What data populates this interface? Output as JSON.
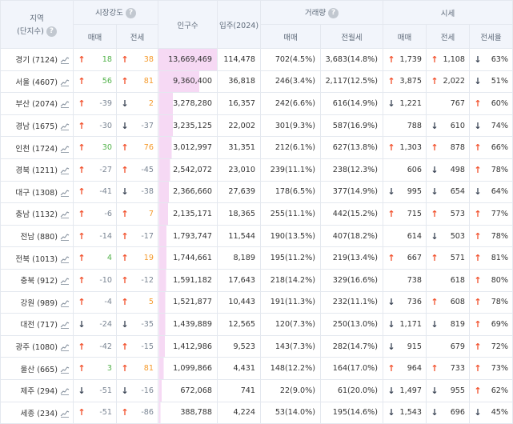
{
  "header": {
    "region": "지역",
    "region_sub": "(단지수)",
    "market_strength": "시장강도",
    "population": "인구수",
    "move_in": "입주(2024)",
    "volume": "거래량",
    "price": "시세",
    "sale": "매매",
    "jeonse": "전세",
    "rent": "전월세",
    "jeonse_rate": "전세율",
    "help": "?"
  },
  "rows": [
    {
      "region": "경기 (7124)",
      "ms_sale_dir": "up",
      "ms_sale": "18",
      "ms_jeonse_dir": "up",
      "ms_jeonse": "38",
      "pop": "13,669,469",
      "pop_pct": 1.0,
      "movein": "114,478",
      "vol_sale": "702(4.5%)",
      "vol_rent": "3,683(14.8%)",
      "pr_sale_dir": "up",
      "pr_sale": "1,739",
      "pr_jeonse_dir": "up",
      "pr_jeonse": "1,108",
      "rate_dir": "down",
      "rate": "63%"
    },
    {
      "region": "서울 (4607)",
      "ms_sale_dir": "up",
      "ms_sale": "56",
      "ms_jeonse_dir": "up",
      "ms_jeonse": "81",
      "pop": "9,360,400",
      "pop_pct": 0.685,
      "movein": "36,818",
      "vol_sale": "246(3.4%)",
      "vol_rent": "2,117(12.5%)",
      "pr_sale_dir": "up",
      "pr_sale": "3,875",
      "pr_jeonse_dir": "up",
      "pr_jeonse": "2,022",
      "rate_dir": "down",
      "rate": "51%"
    },
    {
      "region": "부산 (2074)",
      "ms_sale_dir": "up",
      "ms_sale": "-39",
      "ms_jeonse_dir": "down",
      "ms_jeonse": "2",
      "pop": "3,278,280",
      "pop_pct": 0.24,
      "movein": "16,357",
      "vol_sale": "242(6.6%)",
      "vol_rent": "616(14.9%)",
      "pr_sale_dir": "down",
      "pr_sale": "1,221",
      "pr_jeonse_dir": "",
      "pr_jeonse": "767",
      "rate_dir": "up",
      "rate": "60%"
    },
    {
      "region": "경남 (1675)",
      "ms_sale_dir": "up",
      "ms_sale": "-30",
      "ms_jeonse_dir": "down",
      "ms_jeonse": "-37",
      "pop": "3,235,125",
      "pop_pct": 0.237,
      "movein": "22,002",
      "vol_sale": "301(9.3%)",
      "vol_rent": "587(16.9%)",
      "pr_sale_dir": "",
      "pr_sale": "788",
      "pr_jeonse_dir": "down",
      "pr_jeonse": "610",
      "rate_dir": "down",
      "rate": "74%"
    },
    {
      "region": "인천 (1724)",
      "ms_sale_dir": "up",
      "ms_sale": "30",
      "ms_jeonse_dir": "up",
      "ms_jeonse": "76",
      "pop": "3,012,997",
      "pop_pct": 0.22,
      "movein": "31,351",
      "vol_sale": "212(6.1%)",
      "vol_rent": "627(13.8%)",
      "pr_sale_dir": "up",
      "pr_sale": "1,303",
      "pr_jeonse_dir": "up",
      "pr_jeonse": "878",
      "rate_dir": "up",
      "rate": "66%"
    },
    {
      "region": "경북 (1211)",
      "ms_sale_dir": "up",
      "ms_sale": "-27",
      "ms_jeonse_dir": "up",
      "ms_jeonse": "-45",
      "pop": "2,542,072",
      "pop_pct": 0.186,
      "movein": "23,010",
      "vol_sale": "239(11.1%)",
      "vol_rent": "238(12.3%)",
      "pr_sale_dir": "",
      "pr_sale": "606",
      "pr_jeonse_dir": "down",
      "pr_jeonse": "498",
      "rate_dir": "up",
      "rate": "78%"
    },
    {
      "region": "대구 (1308)",
      "ms_sale_dir": "up",
      "ms_sale": "-41",
      "ms_jeonse_dir": "down",
      "ms_jeonse": "-38",
      "pop": "2,366,660",
      "pop_pct": 0.173,
      "movein": "27,639",
      "vol_sale": "178(6.5%)",
      "vol_rent": "377(14.9%)",
      "pr_sale_dir": "down",
      "pr_sale": "995",
      "pr_jeonse_dir": "down",
      "pr_jeonse": "654",
      "rate_dir": "down",
      "rate": "64%"
    },
    {
      "region": "충남 (1132)",
      "ms_sale_dir": "up",
      "ms_sale": "-6",
      "ms_jeonse_dir": "up",
      "ms_jeonse": "7",
      "pop": "2,135,171",
      "pop_pct": 0.156,
      "movein": "18,365",
      "vol_sale": "255(11.1%)",
      "vol_rent": "442(15.2%)",
      "pr_sale_dir": "up",
      "pr_sale": "715",
      "pr_jeonse_dir": "up",
      "pr_jeonse": "573",
      "rate_dir": "up",
      "rate": "77%"
    },
    {
      "region": "전남 (880)",
      "ms_sale_dir": "up",
      "ms_sale": "-14",
      "ms_jeonse_dir": "up",
      "ms_jeonse": "-17",
      "pop": "1,793,747",
      "pop_pct": 0.131,
      "movein": "11,544",
      "vol_sale": "190(13.5%)",
      "vol_rent": "407(18.2%)",
      "pr_sale_dir": "",
      "pr_sale": "614",
      "pr_jeonse_dir": "down",
      "pr_jeonse": "503",
      "rate_dir": "up",
      "rate": "78%"
    },
    {
      "region": "전북 (1013)",
      "ms_sale_dir": "up",
      "ms_sale": "4",
      "ms_jeonse_dir": "up",
      "ms_jeonse": "19",
      "pop": "1,744,661",
      "pop_pct": 0.128,
      "movein": "8,189",
      "vol_sale": "195(11.2%)",
      "vol_rent": "219(13.4%)",
      "pr_sale_dir": "up",
      "pr_sale": "667",
      "pr_jeonse_dir": "up",
      "pr_jeonse": "571",
      "rate_dir": "up",
      "rate": "81%"
    },
    {
      "region": "충북 (912)",
      "ms_sale_dir": "up",
      "ms_sale": "-10",
      "ms_jeonse_dir": "up",
      "ms_jeonse": "-12",
      "pop": "1,591,182",
      "pop_pct": 0.116,
      "movein": "17,643",
      "vol_sale": "218(14.2%)",
      "vol_rent": "329(16.6%)",
      "pr_sale_dir": "",
      "pr_sale": "738",
      "pr_jeonse_dir": "",
      "pr_jeonse": "618",
      "rate_dir": "up",
      "rate": "80%"
    },
    {
      "region": "강원 (989)",
      "ms_sale_dir": "up",
      "ms_sale": "-4",
      "ms_jeonse_dir": "up",
      "ms_jeonse": "5",
      "pop": "1,521,877",
      "pop_pct": 0.111,
      "movein": "10,443",
      "vol_sale": "191(11.3%)",
      "vol_rent": "232(11.1%)",
      "pr_sale_dir": "down",
      "pr_sale": "736",
      "pr_jeonse_dir": "up",
      "pr_jeonse": "608",
      "rate_dir": "up",
      "rate": "78%"
    },
    {
      "region": "대전 (717)",
      "ms_sale_dir": "down",
      "ms_sale": "-24",
      "ms_jeonse_dir": "down",
      "ms_jeonse": "-35",
      "pop": "1,439,889",
      "pop_pct": 0.105,
      "movein": "12,565",
      "vol_sale": "120(7.3%)",
      "vol_rent": "250(13.0%)",
      "pr_sale_dir": "down",
      "pr_sale": "1,171",
      "pr_jeonse_dir": "down",
      "pr_jeonse": "819",
      "rate_dir": "up",
      "rate": "69%"
    },
    {
      "region": "광주 (1080)",
      "ms_sale_dir": "up",
      "ms_sale": "-42",
      "ms_jeonse_dir": "up",
      "ms_jeonse": "-15",
      "pop": "1,412,986",
      "pop_pct": 0.103,
      "movein": "9,523",
      "vol_sale": "143(7.3%)",
      "vol_rent": "282(14.7%)",
      "pr_sale_dir": "down",
      "pr_sale": "915",
      "pr_jeonse_dir": "",
      "pr_jeonse": "679",
      "rate_dir": "up",
      "rate": "72%"
    },
    {
      "region": "울산 (665)",
      "ms_sale_dir": "up",
      "ms_sale": "3",
      "ms_jeonse_dir": "up",
      "ms_jeonse": "81",
      "pop": "1,099,866",
      "pop_pct": 0.08,
      "movein": "4,431",
      "vol_sale": "148(12.2%)",
      "vol_rent": "164(17.0%)",
      "pr_sale_dir": "up",
      "pr_sale": "964",
      "pr_jeonse_dir": "up",
      "pr_jeonse": "733",
      "rate_dir": "up",
      "rate": "73%"
    },
    {
      "region": "제주 (294)",
      "ms_sale_dir": "down",
      "ms_sale": "-51",
      "ms_jeonse_dir": "down",
      "ms_jeonse": "-16",
      "pop": "672,068",
      "pop_pct": 0.049,
      "movein": "741",
      "vol_sale": "22(9.0%)",
      "vol_rent": "61(20.0%)",
      "pr_sale_dir": "down",
      "pr_sale": "1,497",
      "pr_jeonse_dir": "down",
      "pr_jeonse": "955",
      "rate_dir": "up",
      "rate": "62%"
    },
    {
      "region": "세종 (234)",
      "ms_sale_dir": "up",
      "ms_sale": "-51",
      "ms_jeonse_dir": "up",
      "ms_jeonse": "-86",
      "pop": "388,788",
      "pop_pct": 0.028,
      "movein": "4,224",
      "vol_sale": "53(14.0%)",
      "vol_rent": "195(14.6%)",
      "pr_sale_dir": "down",
      "pr_sale": "1,543",
      "pr_jeonse_dir": "down",
      "pr_jeonse": "696",
      "rate_dir": "down",
      "rate": "45%"
    }
  ],
  "colors": {
    "up": "#f2512d",
    "down": "#3a4454",
    "positive_sale": "#52b24a",
    "positive_jeonse": "#f59a2b",
    "negative": "#7a8593",
    "pop_bar": "#f6d9f4"
  }
}
